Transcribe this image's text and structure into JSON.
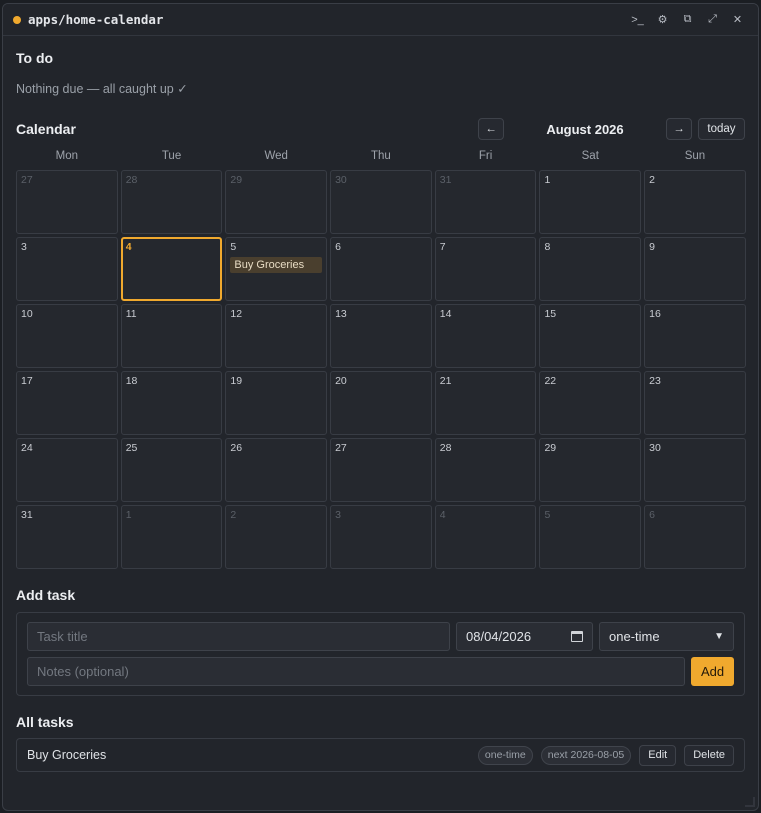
{
  "window": {
    "title": "apps/home-calendar",
    "accent": "#f0a92e",
    "controls": [
      {
        "name": "terminal-icon",
        "glyph": ">_"
      },
      {
        "name": "gear-icon",
        "glyph": "⚙"
      },
      {
        "name": "copy-icon",
        "glyph": "⧉"
      },
      {
        "name": "expand-icon",
        "glyph": "⤢"
      },
      {
        "name": "close-icon",
        "glyph": "✕"
      }
    ]
  },
  "todo": {
    "heading": "To do",
    "message": "Nothing due — all caught up ✓"
  },
  "calendar": {
    "heading": "Calendar",
    "prev_label": "←",
    "next_label": "→",
    "month_label": "August 2026",
    "today_label": "today",
    "weekdays": [
      "Mon",
      "Tue",
      "Wed",
      "Thu",
      "Fri",
      "Sat",
      "Sun"
    ],
    "today_day": 4,
    "days": [
      {
        "n": "27",
        "other": true
      },
      {
        "n": "28",
        "other": true
      },
      {
        "n": "29",
        "other": true
      },
      {
        "n": "30",
        "other": true
      },
      {
        "n": "31",
        "other": true
      },
      {
        "n": "1"
      },
      {
        "n": "2"
      },
      {
        "n": "3"
      },
      {
        "n": "4",
        "today": true
      },
      {
        "n": "5",
        "events": [
          "Buy Groceries"
        ]
      },
      {
        "n": "6"
      },
      {
        "n": "7"
      },
      {
        "n": "8"
      },
      {
        "n": "9"
      },
      {
        "n": "10"
      },
      {
        "n": "11"
      },
      {
        "n": "12"
      },
      {
        "n": "13"
      },
      {
        "n": "14"
      },
      {
        "n": "15"
      },
      {
        "n": "16"
      },
      {
        "n": "17"
      },
      {
        "n": "18"
      },
      {
        "n": "19"
      },
      {
        "n": "20"
      },
      {
        "n": "21"
      },
      {
        "n": "22"
      },
      {
        "n": "23"
      },
      {
        "n": "24"
      },
      {
        "n": "25"
      },
      {
        "n": "26"
      },
      {
        "n": "27"
      },
      {
        "n": "28"
      },
      {
        "n": "29"
      },
      {
        "n": "30"
      },
      {
        "n": "31"
      },
      {
        "n": "1",
        "other": true
      },
      {
        "n": "2",
        "other": true
      },
      {
        "n": "3",
        "other": true
      },
      {
        "n": "4",
        "other": true
      },
      {
        "n": "5",
        "other": true
      },
      {
        "n": "6",
        "other": true
      }
    ]
  },
  "add_task": {
    "heading": "Add task",
    "title_placeholder": "Task title",
    "date_value": "08/04/2026",
    "recurrence_value": "one-time",
    "notes_placeholder": "Notes (optional)",
    "add_label": "Add"
  },
  "all_tasks": {
    "heading": "All tasks",
    "tasks": [
      {
        "name": "Buy Groceries",
        "type": "one-time",
        "next": "next 2026-08-05",
        "edit_label": "Edit",
        "delete_label": "Delete"
      }
    ]
  }
}
